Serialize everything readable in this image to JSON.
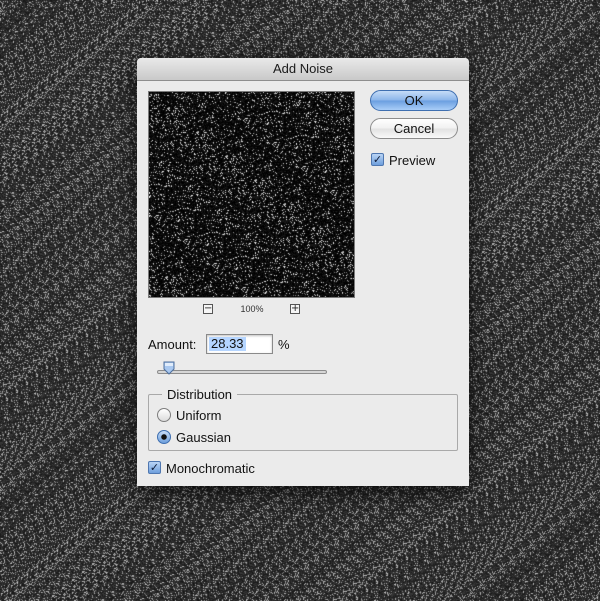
{
  "dialog": {
    "title": "Add Noise",
    "ok_label": "OK",
    "cancel_label": "Cancel",
    "preview_label": "Preview",
    "preview_checked": true,
    "zoom_minus": "−",
    "zoom_plus": "+",
    "zoom_level": "100%",
    "amount_label": "Amount:",
    "amount_value": "28.33",
    "amount_unit": "%",
    "amount_slider_fraction": 0.0708,
    "distribution_label": "Distribution",
    "distribution_options": [
      {
        "label": "Uniform",
        "selected": false
      },
      {
        "label": "Gaussian",
        "selected": true
      }
    ],
    "monochromatic_label": "Monochromatic",
    "monochromatic_checked": true
  },
  "colors": {
    "accent": "#6b9fe0",
    "selection": "#b5d5ff",
    "background": "#2e2e2e"
  }
}
